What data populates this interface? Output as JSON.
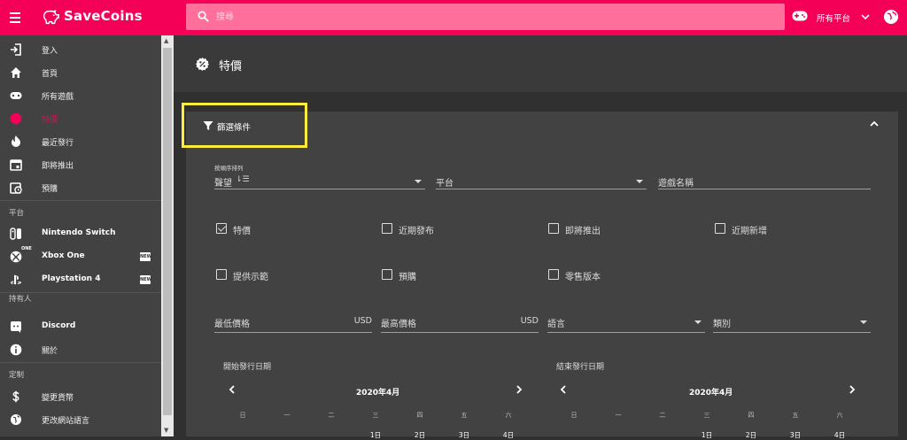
{
  "app": {
    "brand": "SaveCoins",
    "search_placeholder": "搜尋",
    "platform_selector": "所有平台",
    "brand_color": "#f50057"
  },
  "sidebar": {
    "items": [
      {
        "label": "登入",
        "icon": "login-icon"
      },
      {
        "label": "首頁",
        "icon": "home-icon"
      },
      {
        "label": "所有遊戲",
        "icon": "gamepad-icon"
      },
      {
        "label": "特價",
        "icon": "discount-icon",
        "active": true
      },
      {
        "label": "最近發行",
        "icon": "fire-icon"
      },
      {
        "label": "即將推出",
        "icon": "calendar-icon"
      },
      {
        "label": "預購",
        "icon": "calendar-clock-icon"
      }
    ],
    "platform_section": "平台",
    "platforms": [
      {
        "label": "Nintendo Switch",
        "icon": "switch-icon"
      },
      {
        "label": "Xbox One",
        "icon": "xbox-icon",
        "badge": "NEW",
        "icon_badge": "ONE"
      },
      {
        "label": "Playstation 4",
        "icon": "playstation-icon",
        "badge": "NEW"
      }
    ],
    "owner_section": "持有人",
    "owner_items": [
      {
        "label": "Discord",
        "icon": "discord-icon"
      },
      {
        "label": "關於",
        "icon": "info-icon"
      }
    ],
    "custom_section": "定制",
    "custom_items": [
      {
        "label": "變更貨幣",
        "icon": "dollar-icon"
      },
      {
        "label": "更改網站語言",
        "icon": "globe-icon"
      }
    ]
  },
  "page": {
    "title": "特價"
  },
  "filters": {
    "header": "篩選條件",
    "sort": {
      "label": "按順序排列",
      "value": "聲望"
    },
    "platform": {
      "placeholder": "平台"
    },
    "game_name": {
      "placeholder": "遊戲名稱"
    },
    "checkboxes": [
      {
        "label": "特價",
        "checked": true
      },
      {
        "label": "近期發布",
        "checked": false
      },
      {
        "label": "即將推出",
        "checked": false
      },
      {
        "label": "近期新增",
        "checked": false
      },
      {
        "label": "提供示範",
        "checked": false
      },
      {
        "label": "預購",
        "checked": false
      },
      {
        "label": "零售版本",
        "checked": false
      }
    ],
    "min_price": {
      "placeholder": "最低價格",
      "unit": "USD"
    },
    "max_price": {
      "placeholder": "最高價格",
      "unit": "USD"
    },
    "language": {
      "placeholder": "語言"
    },
    "category": {
      "placeholder": "類別"
    },
    "start_calendar": {
      "title": "開始發行日期",
      "month": "2020年4月",
      "weekdays": [
        "日",
        "一",
        "二",
        "三",
        "四",
        "五",
        "六"
      ],
      "first_row": [
        "1日",
        "2日",
        "3日",
        "4日"
      ]
    },
    "end_calendar": {
      "title": "結束發行日期",
      "month": "2020年4月",
      "weekdays": [
        "日",
        "一",
        "二",
        "三",
        "四",
        "五",
        "六"
      ],
      "first_row": [
        "1日",
        "2日",
        "3日",
        "4日"
      ]
    }
  }
}
